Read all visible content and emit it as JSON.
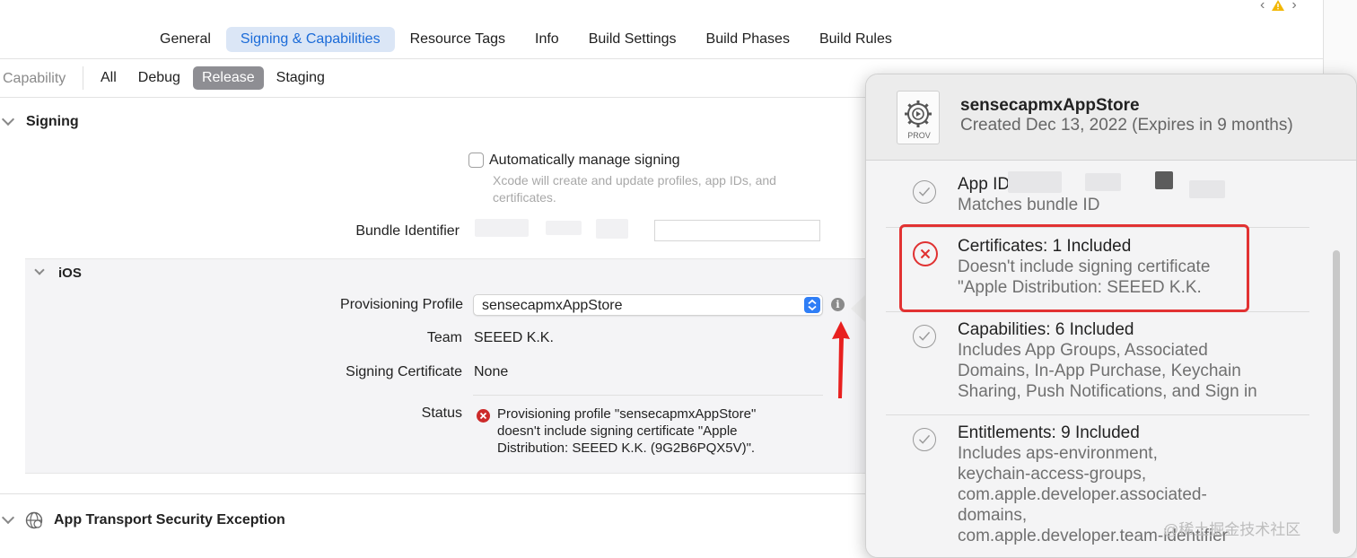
{
  "tabs": [
    "General",
    "Signing & Capabilities",
    "Resource Tags",
    "Info",
    "Build Settings",
    "Build Phases",
    "Build Rules"
  ],
  "active_tab": "Signing & Capabilities",
  "filter": {
    "capability_label": "Capability",
    "items": [
      "All",
      "Debug",
      "Release",
      "Staging"
    ],
    "active": "Release"
  },
  "signing": {
    "title": "Signing",
    "auto_manage_label": "Automatically manage signing",
    "auto_manage_hint_1": "Xcode will create and update profiles, app IDs, and",
    "auto_manage_hint_2": "certificates.",
    "bundle_identifier_label": "Bundle Identifier"
  },
  "ios": {
    "title": "iOS",
    "provisioning_profile_label": "Provisioning Profile",
    "provisioning_profile_value": "sensecapmxAppStore",
    "team_label": "Team",
    "team_value": "SEEED K.K.",
    "signing_certificate_label": "Signing Certificate",
    "signing_certificate_value": "None",
    "status_label": "Status",
    "status_line_1": "Provisioning profile \"sensecapmxAppStore\"",
    "status_line_2": "doesn't include signing certificate \"Apple",
    "status_line_3": "Distribution: SEEED K.K. (9G2B6PQX5V)\"."
  },
  "ats": {
    "title": "App Transport Security Exception"
  },
  "popover": {
    "file_label": "PROV",
    "title": "sensecapmxAppStore",
    "subtitle": "Created Dec 13, 2022 (Expires in 9 months)",
    "items": [
      {
        "title": "App ID",
        "desc": [
          "Matches bundle ID"
        ]
      },
      {
        "title": "Certificates: 1 Included",
        "desc": [
          "Doesn't include signing certificate",
          "\"Apple Distribution: SEEED K.K."
        ]
      },
      {
        "title": "Capabilities: 6 Included",
        "desc": [
          "Includes App Groups, Associated",
          "Domains, In-App Purchase, Keychain",
          "Sharing, Push Notifications, and Sign in"
        ]
      },
      {
        "title": "Entitlements: 9 Included",
        "desc": [
          "Includes aps-environment,",
          "keychain-access-groups,",
          "com.apple.developer.associated-",
          "domains,",
          "com.apple.developer.team-identifier"
        ]
      }
    ]
  },
  "watermark": "@稀土掘金技术社区",
  "colors": {
    "accent": "#1b6bd8",
    "error": "#e23232",
    "active_filter": "#8e8e93"
  }
}
